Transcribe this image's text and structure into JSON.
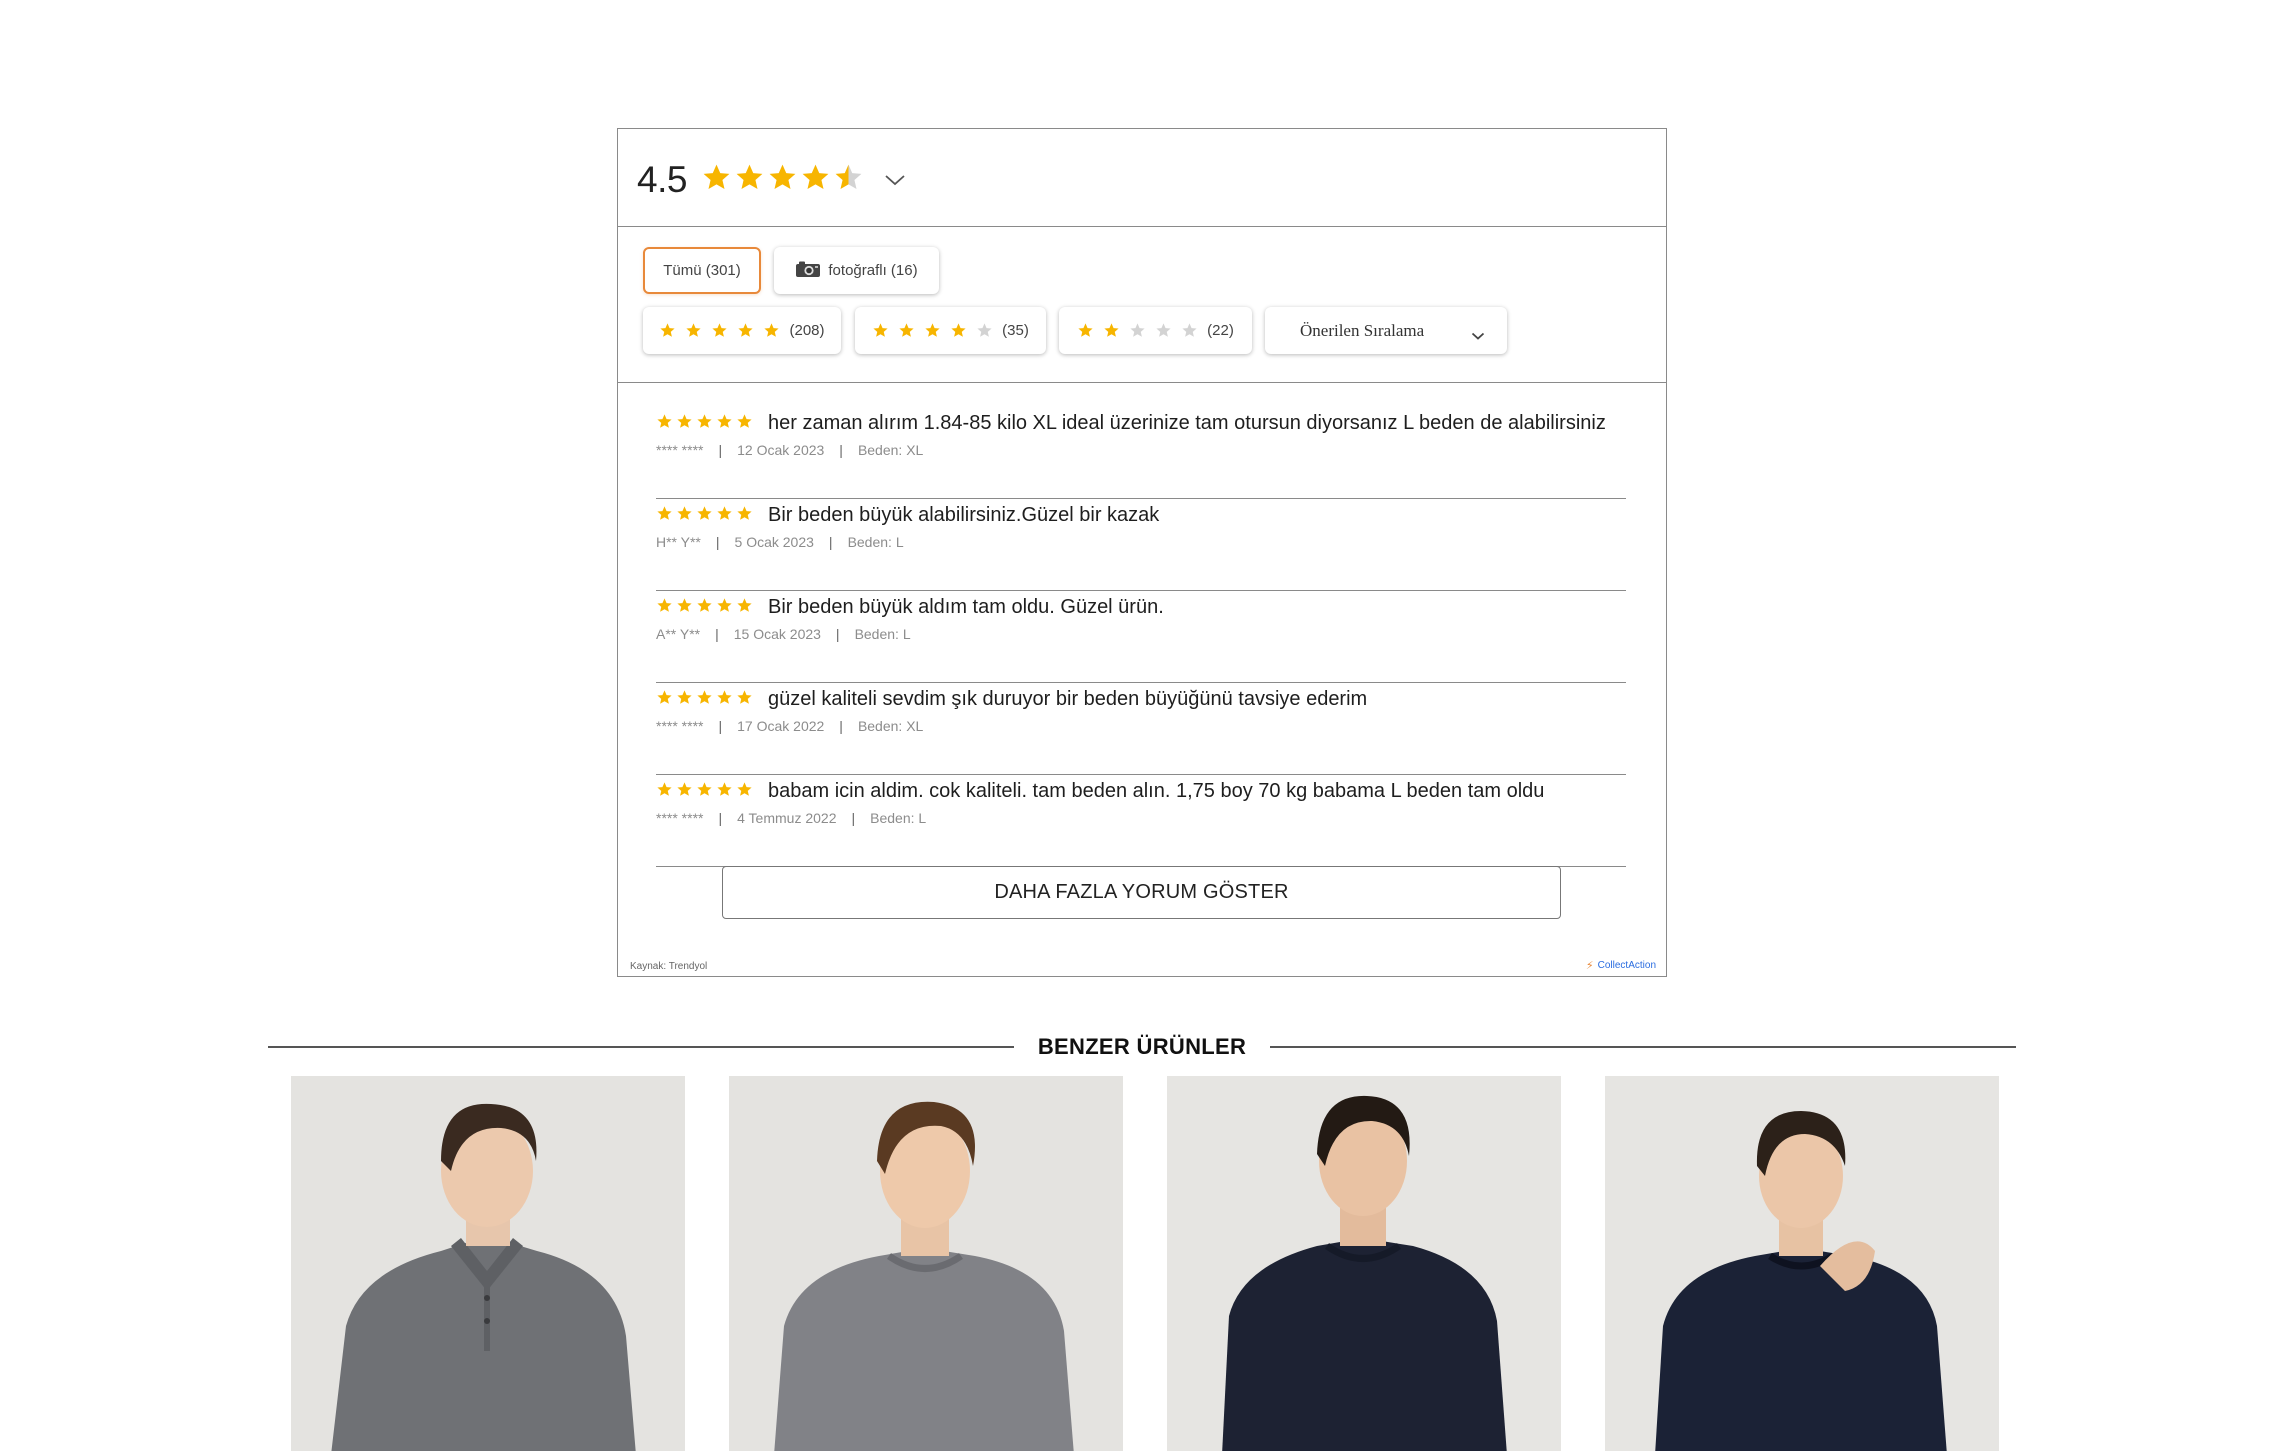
{
  "rating": {
    "average": "4.5",
    "stars_value": 4.5
  },
  "filters": {
    "all_label": "Tümü (301)",
    "photo_label": "fotoğraflı (16)",
    "star_chips": [
      {
        "stars": 5,
        "count": "(208)"
      },
      {
        "stars": 4,
        "count": "(35)"
      },
      {
        "stars": 2,
        "count": "(22)"
      }
    ],
    "sort_label": "Önerilen Sıralama"
  },
  "reviews": [
    {
      "stars": 5,
      "text": "her zaman alırım 1.84-85 kilo XL ideal üzerinize tam otursun diyorsanız L beden de alabilirsiniz",
      "author": "**** ****",
      "date": "12 Ocak 2023",
      "size": "Beden: XL"
    },
    {
      "stars": 5,
      "text": "Bir beden büyük alabilirsiniz.Güzel bir kazak",
      "author": "H** Y**",
      "date": "5 Ocak 2023",
      "size": "Beden: L"
    },
    {
      "stars": 5,
      "text": "Bir beden büyük aldım tam oldu. Güzel ürün.",
      "author": "A** Y**",
      "date": "15 Ocak 2023",
      "size": "Beden: L"
    },
    {
      "stars": 5,
      "text": "güzel kaliteli sevdim şık duruyor bir beden büyüğünü tavsiye ederim",
      "author": "**** ****",
      "date": "17 Ocak 2022",
      "size": "Beden: XL"
    },
    {
      "stars": 5,
      "text": "babam icin aldim. cok kaliteli. tam beden alın. 1,75 boy 70 kg babama L beden tam oldu",
      "author": "**** ****",
      "date": "4 Temmuz 2022",
      "size": "Beden: L"
    }
  ],
  "more_button_label": "DAHA FAZLA YORUM GÖSTER",
  "source_label": "Kaynak: Trendyol",
  "powered_label": "CollectAction",
  "similar": {
    "title": "BENZER ÜRÜNLER",
    "products": [
      {
        "image": "grey-polo-sweater"
      },
      {
        "image": "grey-crewneck-sweater"
      },
      {
        "image": "navy-crewneck-sweater"
      },
      {
        "image": "navy-textured-sweater"
      }
    ]
  },
  "colors": {
    "star": "#f7b500",
    "star_empty": "#d3d3d3",
    "accent": "#e8893a",
    "link": "#2b6de0"
  }
}
